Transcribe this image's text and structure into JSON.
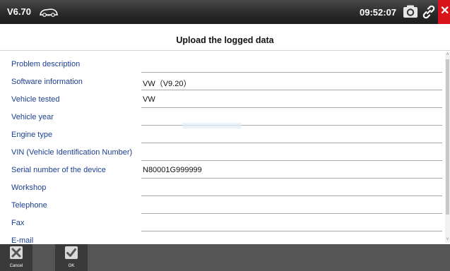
{
  "header": {
    "version": "V6.70",
    "brand_icon": "vw-car-icon",
    "time": "09:52:07",
    "icons": [
      "camera-icon",
      "link-icon",
      "close-icon"
    ],
    "close_color": "#d8131b"
  },
  "page": {
    "title": "Upload the logged data"
  },
  "form": {
    "rows": [
      {
        "label": "Problem description",
        "value": ""
      },
      {
        "label": "Software information",
        "value": "VW（V9.20）"
      },
      {
        "label": "Vehicle tested",
        "value": "VW"
      },
      {
        "label": "Vehicle year",
        "value": ""
      },
      {
        "label": "Engine type",
        "value": ""
      },
      {
        "label": "VIN (Vehicle Identification Number)",
        "value": ""
      },
      {
        "label": "Serial number of the device",
        "value": "N80001G999999"
      },
      {
        "label": "Workshop",
        "value": ""
      },
      {
        "label": "Telephone",
        "value": ""
      },
      {
        "label": "Fax",
        "value": ""
      },
      {
        "label": "E-mail",
        "value": ""
      }
    ]
  },
  "footer": {
    "cancel_label": "Cancel",
    "ok_label": "OK"
  }
}
